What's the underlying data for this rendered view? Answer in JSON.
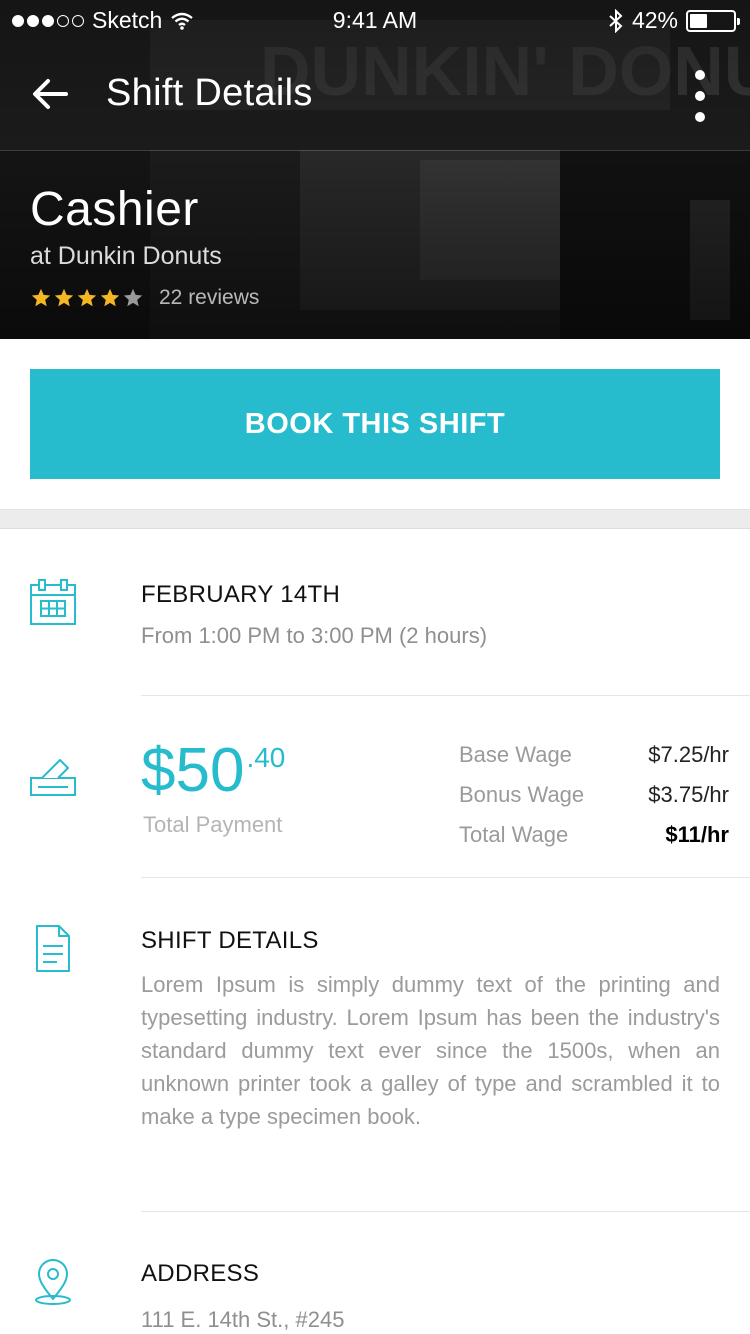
{
  "status_bar": {
    "carrier": "Sketch",
    "time": "9:41 AM",
    "battery": "42%",
    "signal_dots_filled": 3,
    "signal_dots_total": 5
  },
  "nav": {
    "title": "Shift Details"
  },
  "job": {
    "title": "Cashier",
    "company": "at Dunkin Donuts",
    "rating": 4,
    "rating_max": 5,
    "reviews": "22 reviews"
  },
  "book_button": "BOOK THIS SHIFT",
  "date_section": {
    "heading": "FEBRUARY 14TH",
    "time_range": "From 1:00 PM to 3:00 PM (2 hours)"
  },
  "payment": {
    "amount_main": "$50",
    "amount_cents": ".40",
    "label": "Total Payment",
    "wages": [
      {
        "label": "Base Wage",
        "value": "$7.25/hr",
        "bold": false
      },
      {
        "label": "Bonus Wage",
        "value": "$3.75/hr",
        "bold": false
      },
      {
        "label": "Total Wage",
        "value": "$11/hr",
        "bold": true
      }
    ]
  },
  "details_section": {
    "heading": "SHIFT DETAILS",
    "text": "Lorem Ipsum is simply dummy text of the printing and typesetting industry. Lorem Ipsum has been the industry's standard dummy text ever since the 1500s, when an unknown printer took a galley of type and scrambled it to make a type specimen book."
  },
  "address_section": {
    "heading": "ADDRESS",
    "line1": "111 E. 14th St., #245"
  },
  "colors": {
    "accent": "#26bccd",
    "star": "#f5b623",
    "star_empty": "#9a9a9a"
  }
}
